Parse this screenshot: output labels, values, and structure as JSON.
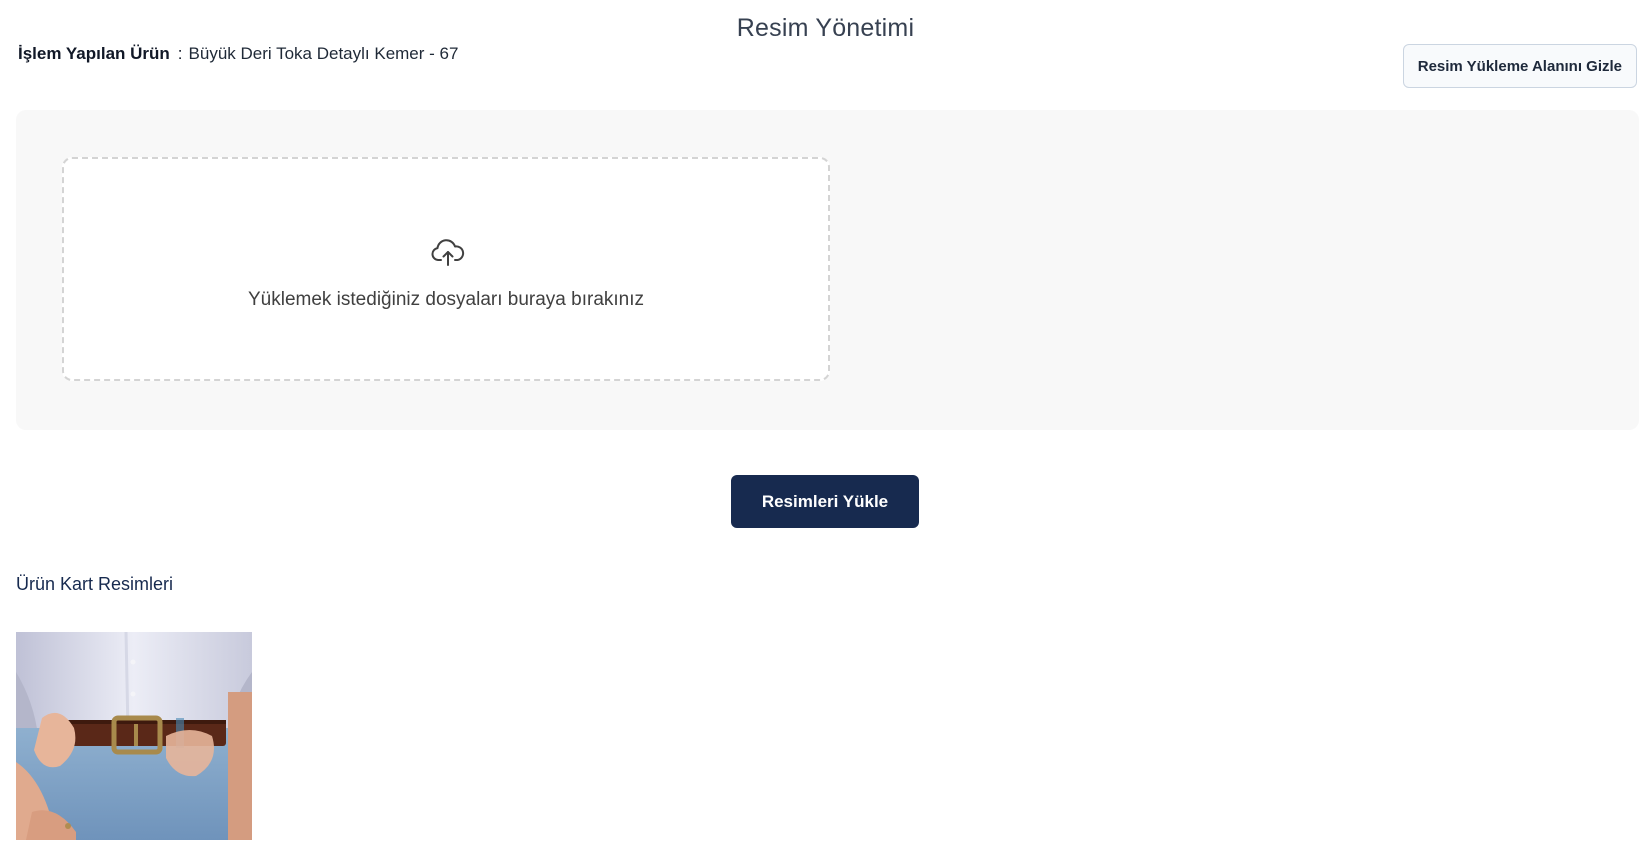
{
  "page": {
    "title": "Resim Yönetimi"
  },
  "product": {
    "label": "İşlem Yapılan Ürün",
    "separator": ":",
    "name": "Büyük Deri Toka Detaylı Kemer - 67"
  },
  "toolbar": {
    "hide_upload_label": "Resim Yükleme Alanını Gizle"
  },
  "dropzone": {
    "icon": "cloud-upload-icon",
    "text": "Yüklemek istediğiniz dosyaları buraya bırakınız"
  },
  "actions": {
    "upload_label": "Resimleri Yükle"
  },
  "images": {
    "section_title": "Ürün Kart Resimleri",
    "items": [
      {
        "subject": "product-photo-belt"
      }
    ]
  },
  "colors": {
    "primary": "#172a4f",
    "panel_bg": "#f8f8f8",
    "dropzone_border": "#d4d4d4"
  }
}
